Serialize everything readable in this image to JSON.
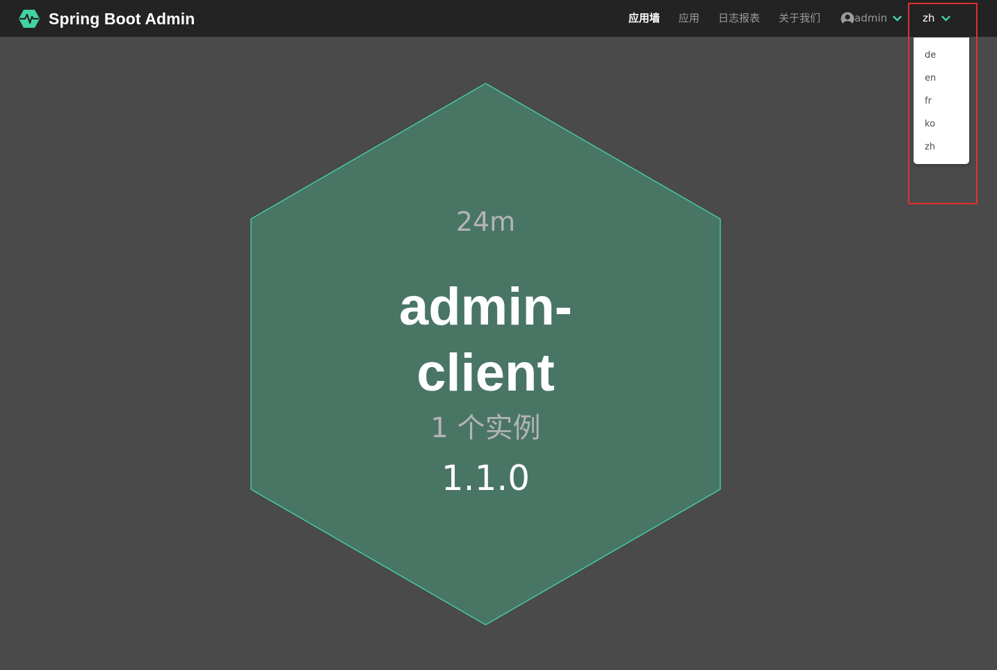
{
  "brand": {
    "title": "Spring Boot Admin",
    "logo_icon": "heartbeat-hexagon-icon",
    "accent_color": "#42d3a5"
  },
  "nav": {
    "items": [
      {
        "label": "应用墙",
        "active": true
      },
      {
        "label": "应用",
        "active": false
      },
      {
        "label": "日志报表",
        "active": false
      },
      {
        "label": "关于我们",
        "active": false
      }
    ],
    "user": {
      "label": "admin",
      "icon": "user-circle-icon",
      "dropdown_icon": "chevron-down-icon"
    },
    "language": {
      "selected": "zh",
      "dropdown_icon": "chevron-down-icon",
      "open": true
    }
  },
  "language_menu": {
    "options": [
      "de",
      "en",
      "fr",
      "ko",
      "zh"
    ]
  },
  "applications": [
    {
      "uptime": "24m",
      "name": "admin-client",
      "instances": "1 个实例",
      "version": "1.1.0",
      "status_color": "#42d3a5",
      "fill_color": "#497565"
    }
  ]
}
